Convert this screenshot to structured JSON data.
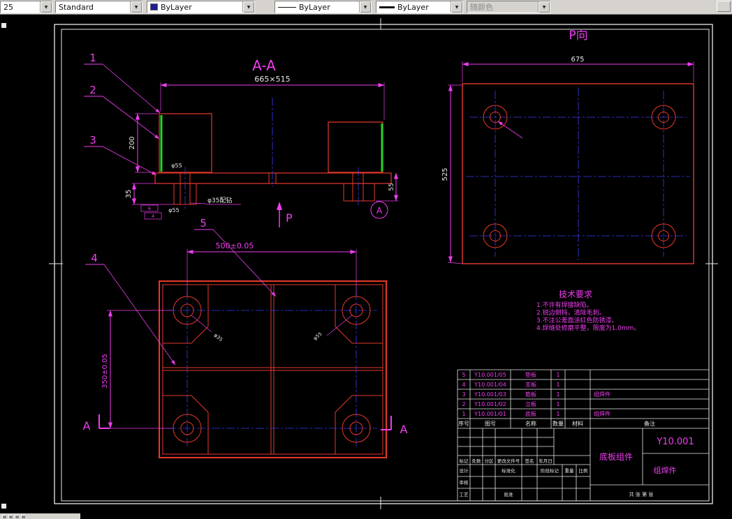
{
  "toolbar": {
    "layer": "25",
    "style": "Standard",
    "color": "ByLayer",
    "linetype": "ByLayer",
    "lineweight": "ByLayer",
    "plotstyle": "随颜色"
  },
  "colors": {
    "entity_red": "#e8392b",
    "dimension_magenta": "#f03df0",
    "centerline_blue": "#3d3df5",
    "weld_green": "#25d425",
    "dim_text_white": "#e9e9e9",
    "paper_line_white": "#ffffff",
    "canvas_background": "#000000"
  },
  "section_view": {
    "title": "A-A",
    "dim_top": "665×515",
    "dim_height": "200",
    "dim_bottom": "35",
    "dim_right": "55",
    "dia_upper": "φ55",
    "dia_lower": "φ55",
    "hole_note": "φ35配钻",
    "weld_note_a": "6",
    "weld_note_b": "4",
    "p_arrow": "P",
    "detail_mark": "A"
  },
  "p_view": {
    "title": "P向",
    "dim_width": "675",
    "dim_height": "525"
  },
  "plan_view": {
    "dim_width": "500±0.05",
    "dim_height": "350±0.05",
    "section_left": "A",
    "section_right": "A",
    "hole_callout_left": "φ35",
    "hole_callout_right": "φ55"
  },
  "balloons": {
    "b1": "1",
    "b2": "2",
    "b3": "3",
    "b4": "4",
    "b5": "5"
  },
  "tech_req": {
    "title": "技术要求",
    "lines": [
      "1.不许有焊接缺陷。",
      "2.锐边倒钝，清除毛刺。",
      "3.不注公差面涂红色防锈漆。",
      "4.焊缝处修磨平整，限度为1.0mm。"
    ]
  },
  "bom": {
    "headers": [
      "序号",
      "图号",
      "名称",
      "数量",
      "材料",
      "备注"
    ],
    "rows": [
      {
        "no": "5",
        "code": "Y10.001/05",
        "name": "垫板",
        "qty": "1",
        "material": "",
        "note": ""
      },
      {
        "no": "4",
        "code": "Y10.001/04",
        "name": "支板",
        "qty": "1",
        "material": "",
        "note": ""
      },
      {
        "no": "3",
        "code": "Y10.001/03",
        "name": "筋板",
        "qty": "1",
        "material": "",
        "note": "组焊件"
      },
      {
        "no": "2",
        "code": "Y10.001/02",
        "name": "立板",
        "qty": "1",
        "material": "",
        "note": ""
      },
      {
        "no": "1",
        "code": "Y10.001/01",
        "name": "底板",
        "qty": "1",
        "material": "",
        "note": "组焊件"
      }
    ]
  },
  "title_block": {
    "part_name": "底板组件",
    "drawing_no": "Y10.001",
    "category": "组焊件",
    "rev_row": [
      "标记",
      "处数",
      "分区",
      "更改文件号",
      "签名",
      "年月日"
    ],
    "design": "设计",
    "standardize": "标准化",
    "audit": "审核",
    "process": "工艺",
    "approve": "批准",
    "stage": "阶段标记",
    "weight": "重量",
    "scale": "比例",
    "sheets": "共 张 第 张"
  }
}
